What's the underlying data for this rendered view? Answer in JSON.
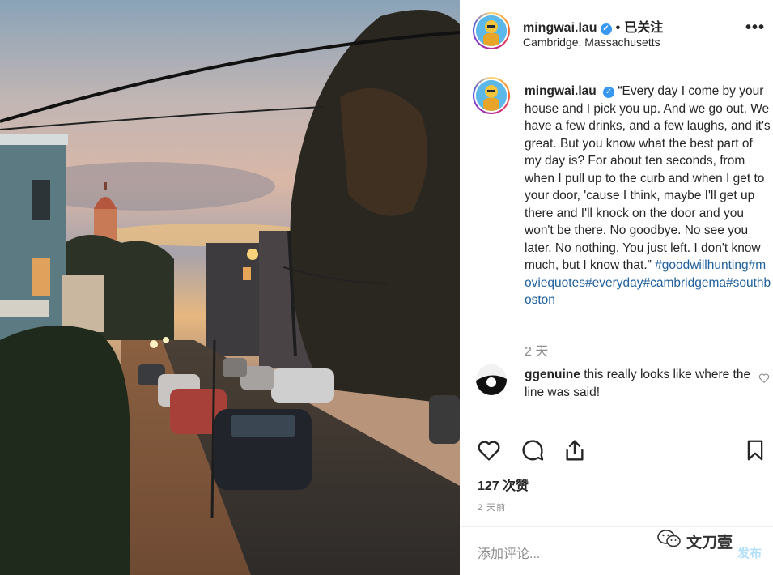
{
  "post": {
    "username": "mingwai.lau",
    "verified_glyph": "✓",
    "separator": "•",
    "follow_status": "已关注",
    "location": "Cambridge, Massachusetts",
    "more_glyph": "•••"
  },
  "caption": {
    "username": "mingwai.lau",
    "text": "“Every day I come by your house and I pick you up. And we go out. We have a few drinks, and a few laughs, and it's great. But you know what the best part of my day is? For about ten seconds, from when I pull up to the curb and when I get to your door, 'cause I think, maybe I'll get up there and I'll knock on the door and you won't be there. No goodbye. No see you later. No nothing. You just left. I don't know much, but I know that.”",
    "hashtags": "#goodwillhunting#moviequotes#everyday#cambridgema#southboston",
    "time": "2 天"
  },
  "comment": {
    "username": "ggenuine",
    "text": "this really looks like where the line was said!"
  },
  "actions": {
    "likes": "127 次赞",
    "time": "2 天前",
    "add_comment_placeholder": "添加评论...",
    "post_label": "发布"
  },
  "watermark": {
    "text": "文刀壹"
  },
  "icons": {
    "like": "heart-icon",
    "comment": "comment-bubble-icon",
    "share": "share-icon",
    "save": "bookmark-icon",
    "comment_like": "heart-outline-small-icon",
    "watermark": "wechat-icon"
  },
  "colors": {
    "hashtag": "#1e5f9c",
    "verified": "#3897f0",
    "muted": "#8e8e8e"
  }
}
